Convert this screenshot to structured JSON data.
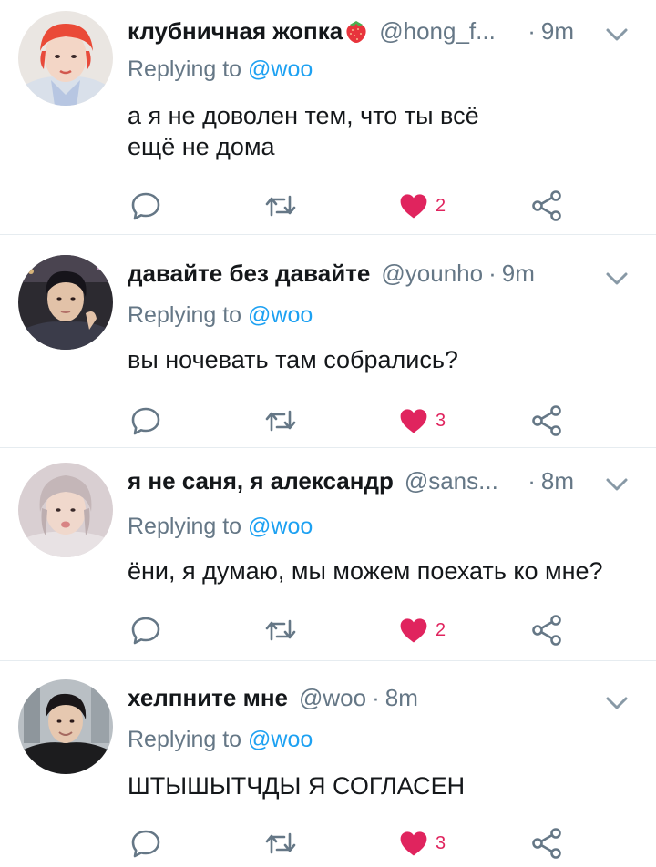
{
  "colors": {
    "accent": "#1da1f2",
    "muted": "#657786",
    "like": "#e0245e",
    "divider": "#e6ecf0"
  },
  "reply_prefix": "Replying to",
  "tweets": [
    {
      "name": "клубничная жопка",
      "handle": "@hong_f...",
      "dot": "·",
      "time": "9m",
      "reply_to": "@woo",
      "text_line1": "а я не доволен тем, что ты всё",
      "text_line2": "ещё не дома",
      "likes": "2",
      "has_strawberry": true
    },
    {
      "name": "давайте без давайте",
      "handle": "@younho",
      "dot": "·",
      "time": "9m",
      "reply_to": "@woo",
      "text_line1": "вы ночевать там собрались?",
      "likes": "3"
    },
    {
      "name": "я не саня, я александр",
      "handle": "@sans...",
      "dot": "·",
      "time": "8m",
      "reply_to": "@woo",
      "text_line1": "ёни, я думаю, мы можем поехать ко мне?",
      "likes": "2"
    },
    {
      "name": "хелпните мне",
      "handle": "@woo",
      "dot": "·",
      "time": "8m",
      "reply_to": "@woo",
      "text_line1": "ШТЫШЫТЧДЫ Я СОГЛАСЕН",
      "likes": "3"
    }
  ],
  "icons": [
    "reply-icon",
    "retweet-icon",
    "heart-icon",
    "share-icon",
    "chevron-down-icon",
    "strawberry-icon"
  ]
}
